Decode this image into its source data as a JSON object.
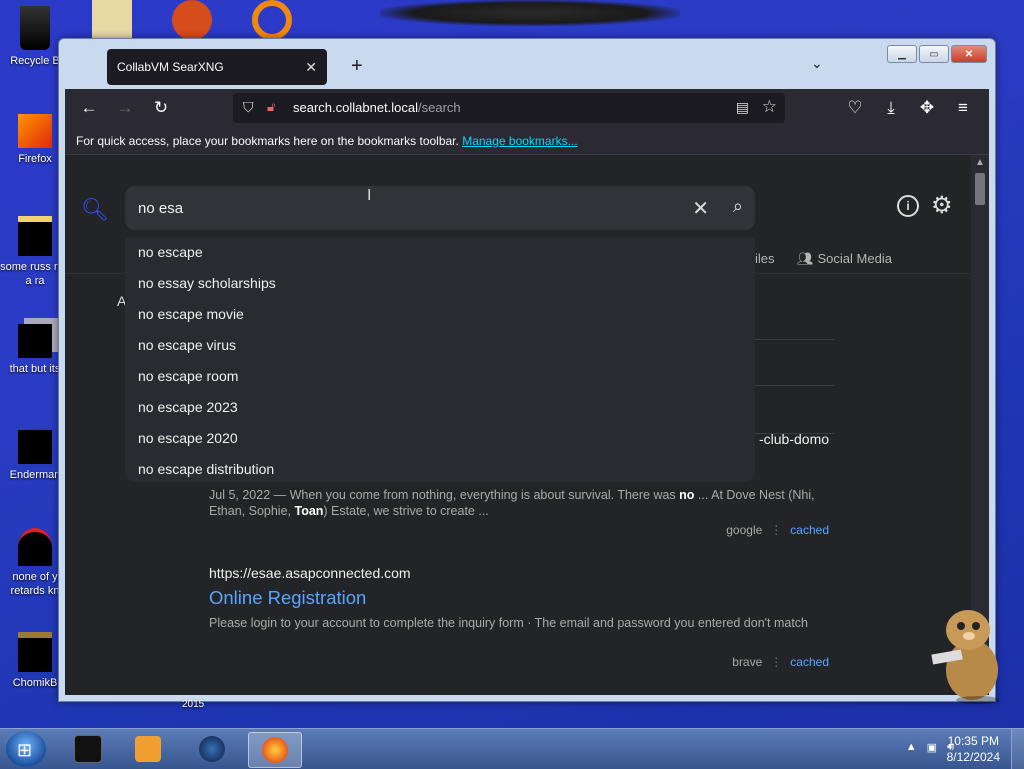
{
  "desktop": {
    "icons": [
      {
        "label": "Recycle B",
        "icon": "recycle-bin-icon"
      },
      {
        "label": "Firefox",
        "icon": "firefox-icon"
      },
      {
        "label": "some russ ran a ra",
        "icon": "file-icon"
      },
      {
        "label": "that but its",
        "icon": "folder-icon"
      },
      {
        "label": "Enderman",
        "icon": "app-icon"
      },
      {
        "label": "none of y retards kn",
        "icon": "app-icon"
      },
      {
        "label": "ChomikB",
        "icon": "app-icon"
      }
    ],
    "stamp": "2015"
  },
  "browser": {
    "tab_title": "CollabVM SearXNG",
    "url_host": "search.collabnet.local",
    "url_path": "/search",
    "bookmarks_hint": "For quick access, place your bookmarks here on the bookmarks toolbar.",
    "bookmarks_link": "Manage bookmarks..."
  },
  "search": {
    "query": "no esa",
    "suggestions": [
      "no escape",
      "no essay scholarships",
      "no escape movie",
      "no escape virus",
      "no escape room",
      "no escape 2023",
      "no escape 2020",
      "no escape distribution"
    ],
    "categories_visible": [
      {
        "label": "Files",
        "shown": "iles"
      },
      {
        "label": "Social Media",
        "shown": "Social Media"
      }
    ],
    "partial_label": "A",
    "peek_text": "-club-domo"
  },
  "results": [
    {
      "date_snippet_parts": [
        "Jul 5, 2022 — When you come from nothing, everything is about survival. There was ",
        "no",
        " ... At Dove Nest (Nhi, Ethan, Sophie, ",
        "Toan",
        ") Estate, we strive to create ..."
      ],
      "engine": "google",
      "cached": "cached"
    },
    {
      "url": "https://esae.asapconnected.com",
      "title": "Online Registration",
      "snippet": "Please login to your account to complete the inquiry form · The email and password you entered don't match",
      "engine": "brave",
      "cached": "cached"
    }
  ],
  "taskbar": {
    "clock_time": "10:35 PM",
    "clock_date": "8/12/2024"
  },
  "colors": {
    "accent": "#58a6ff",
    "brand": "#3050ff",
    "desktop": "#2a3cc4"
  }
}
